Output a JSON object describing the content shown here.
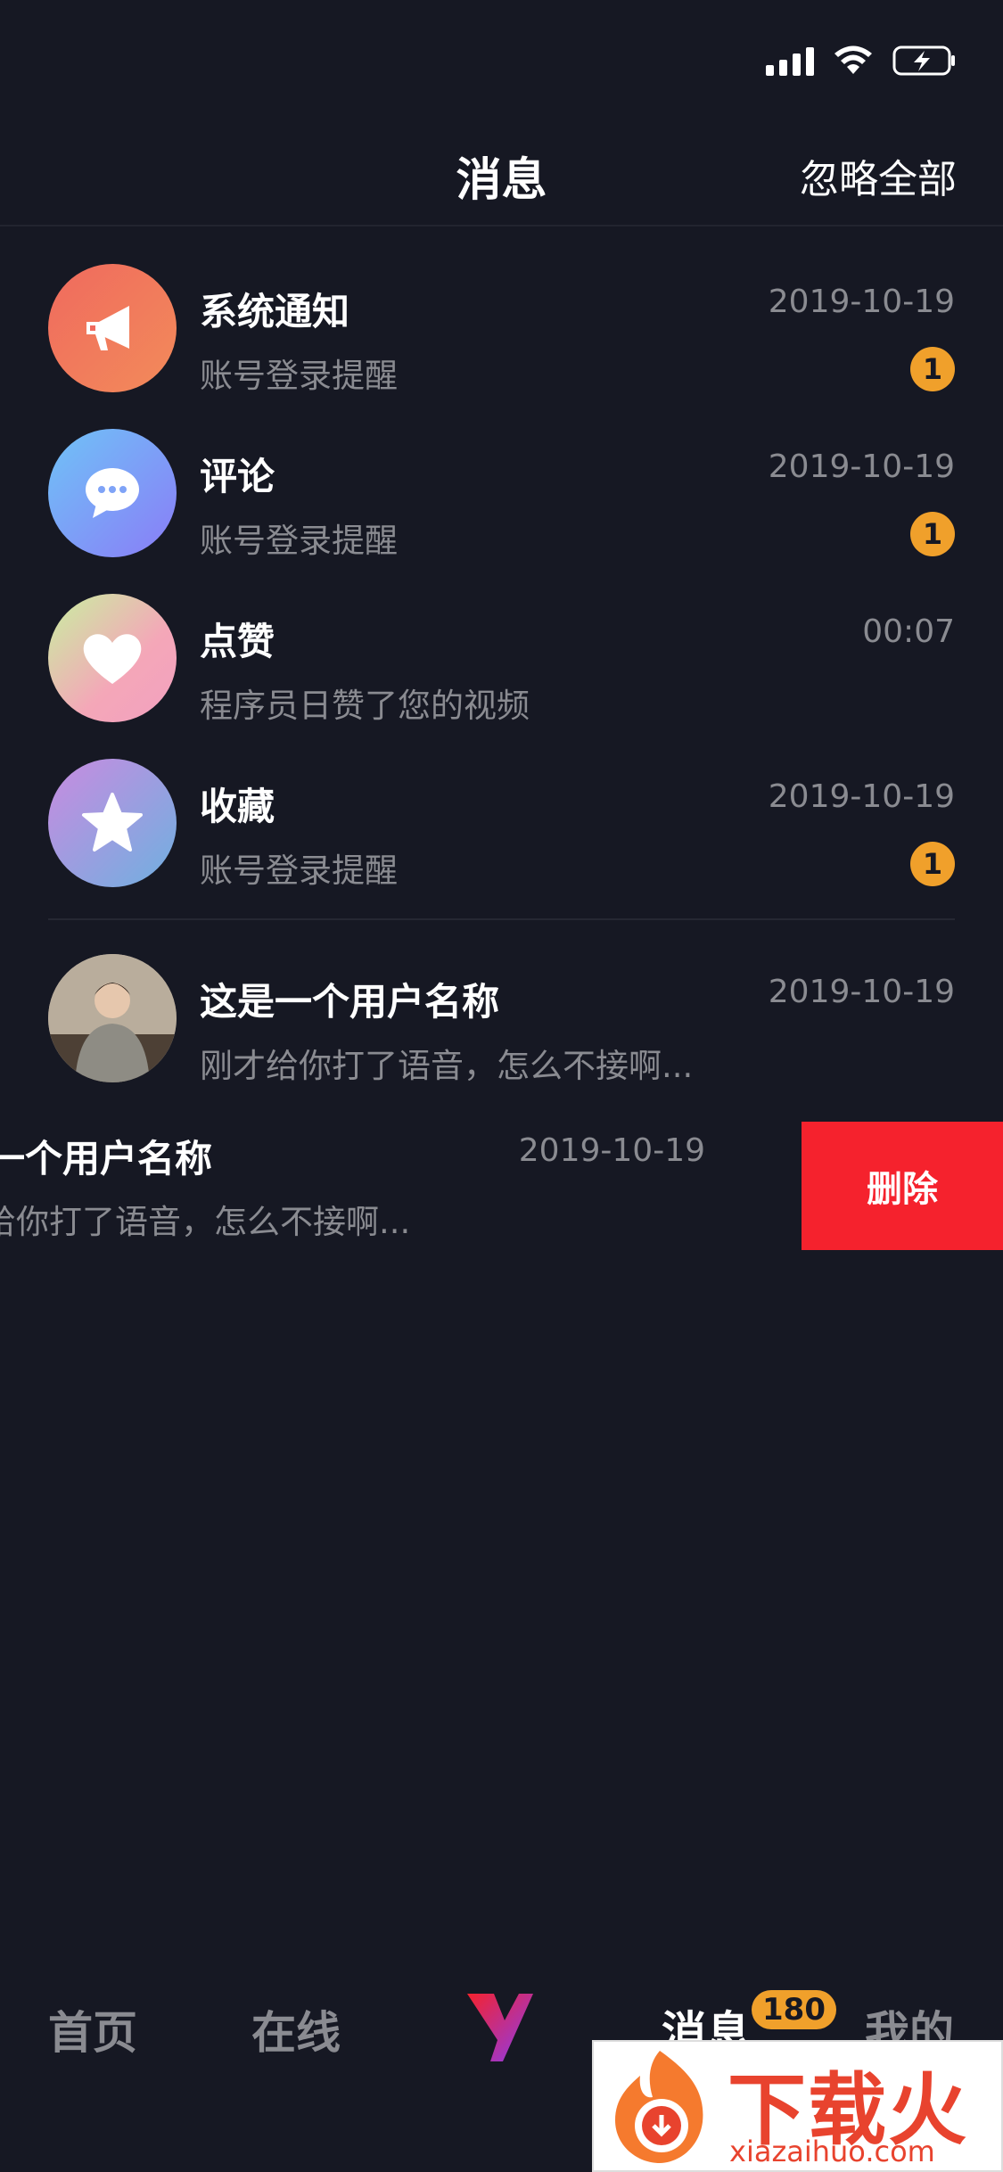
{
  "header": {
    "title": "消息",
    "action": "忽略全部"
  },
  "messages": [
    {
      "name": "系统通知",
      "preview": "账号登录提醒",
      "time": "2019-10-19",
      "badge": "1",
      "icon": "megaphone-icon"
    },
    {
      "name": "评论",
      "preview": "账号登录提醒",
      "time": "2019-10-19",
      "badge": "1",
      "icon": "chat-bubble-icon"
    },
    {
      "name": "点赞",
      "preview": "程序员日赞了您的视频",
      "time": "00:07",
      "badge": "",
      "icon": "heart-icon"
    },
    {
      "name": "收藏",
      "preview": "账号登录提醒",
      "time": "2019-10-19",
      "badge": "1",
      "icon": "star-icon"
    }
  ],
  "chats": [
    {
      "name": "这是一个用户名称",
      "preview": "刚才给你打了语音，怎么不接啊...",
      "time": "2019-10-19"
    }
  ],
  "swiped_chat": {
    "name": "是一个用户名称",
    "preview": "才给你打了语音，怎么不接啊...",
    "time": "2019-10-19",
    "delete_label": "删除"
  },
  "tabs": [
    {
      "label": "首页"
    },
    {
      "label": "在线"
    },
    {
      "label": "消息",
      "badge": "180"
    },
    {
      "label": "我的"
    }
  ],
  "watermark": {
    "title": "下载火",
    "site": "xiazaihuo.com"
  },
  "colors": {
    "background": "#161823",
    "badge": "#f0a02b",
    "delete": "#f5222d",
    "muted_text": "#8a8b91"
  }
}
